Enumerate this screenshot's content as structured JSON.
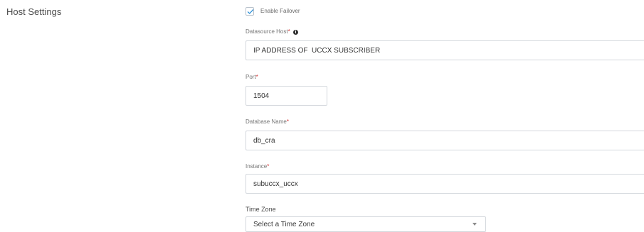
{
  "section": {
    "title": "Host Settings"
  },
  "failover": {
    "label": "Enable Failover",
    "checked": true
  },
  "fields": {
    "datasource_host": {
      "label": "Datasource Host",
      "required_mark": "*",
      "value": "IP ADDRESS OF  UCCX SUBSCRIBER"
    },
    "port": {
      "label": "Port",
      "required_mark": "*",
      "value": "1504"
    },
    "database_name": {
      "label": "Database Name",
      "required_mark": "*",
      "value": "db_cra"
    },
    "instance": {
      "label": "Instance",
      "required_mark": "*",
      "value": "subuccx_uccx"
    },
    "time_zone": {
      "label": "Time Zone",
      "selected": "Select a Time Zone"
    }
  },
  "icons": {
    "check": "check-icon",
    "info": "info-icon",
    "dropdown": "chevron-down-icon"
  },
  "colors": {
    "accent": "#2b8fd6",
    "required": "#d32f2f",
    "border": "#d4d8dd"
  }
}
